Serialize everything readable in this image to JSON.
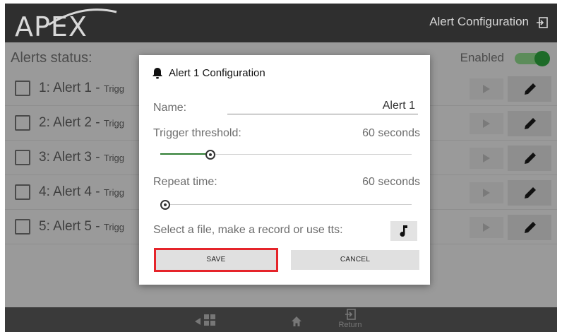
{
  "header": {
    "logo_text": "APEX",
    "title": "Alert Configuration"
  },
  "status": {
    "label": "Alerts status:",
    "enabled_label": "Enabled",
    "enabled": true
  },
  "alerts": [
    {
      "label": "1: Alert 1 - ",
      "sub": "Trigg"
    },
    {
      "label": "2: Alert 2 - ",
      "sub": "Trigg"
    },
    {
      "label": "3: Alert 3 - ",
      "sub": "Trigg"
    },
    {
      "label": "4: Alert 4 - ",
      "sub": "Trigg"
    },
    {
      "label": "5: Alert 5 - ",
      "sub": "Trigg"
    }
  ],
  "modal": {
    "title": "Alert 1 Configuration",
    "name_label": "Name:",
    "name_value": "Alert 1",
    "trigger_label": "Trigger threshold:",
    "trigger_value": "60 seconds",
    "trigger_slider_fraction": 0.2,
    "repeat_label": "Repeat time:",
    "repeat_value": "60 seconds",
    "repeat_slider_fraction": 0.0,
    "file_label": "Select a file, make a record or use tts:",
    "save_label": "SAVE",
    "cancel_label": "CANCEL"
  },
  "bottom_bar": {
    "return_label": "Return"
  },
  "icons": {
    "bell": "bell-icon",
    "music": "music-note-icon",
    "exit": "exit-icon",
    "home": "home-icon",
    "back": "back-arrow-icon",
    "grid": "grid-icon",
    "return": "return-icon",
    "play": "play-icon",
    "edit": "pencil-icon"
  },
  "colors": {
    "accent_green": "#1d6b28",
    "highlight_red": "#e5242a",
    "header_bg": "#2f2f2f"
  }
}
